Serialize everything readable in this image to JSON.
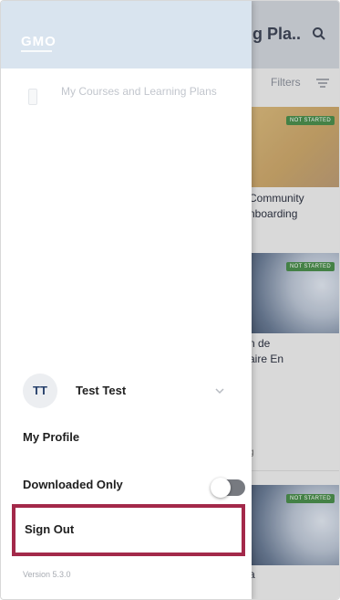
{
  "background_app": {
    "title": "g Pla..",
    "filters_label": "Filters",
    "cards": [
      {
        "badge": "NOT STARTED",
        "text_lines": [
          "Community",
          "nboarding"
        ]
      },
      {
        "badge": "NOT STARTED",
        "text_lines": [
          "n de",
          "aire En"
        ]
      },
      {
        "badge": "NOT STARTED",
        "text_lines": [
          "a"
        ]
      }
    ],
    "partial_text": "g"
  },
  "drawer": {
    "logo": "GMO",
    "menu_items": [
      {
        "label": "My Courses and Learning Plans",
        "icon": "document-icon"
      }
    ],
    "user": {
      "initials": "TT",
      "name": "Test Test"
    },
    "my_profile_label": "My Profile",
    "downloaded_only_label": "Downloaded Only",
    "downloaded_only_enabled": false,
    "sign_out_label": "Sign Out",
    "version": "Version 5.3.0"
  },
  "colors": {
    "highlight": "#a3294a",
    "drawer_header": "#d9e4ef",
    "avatar_text": "#26406a"
  }
}
